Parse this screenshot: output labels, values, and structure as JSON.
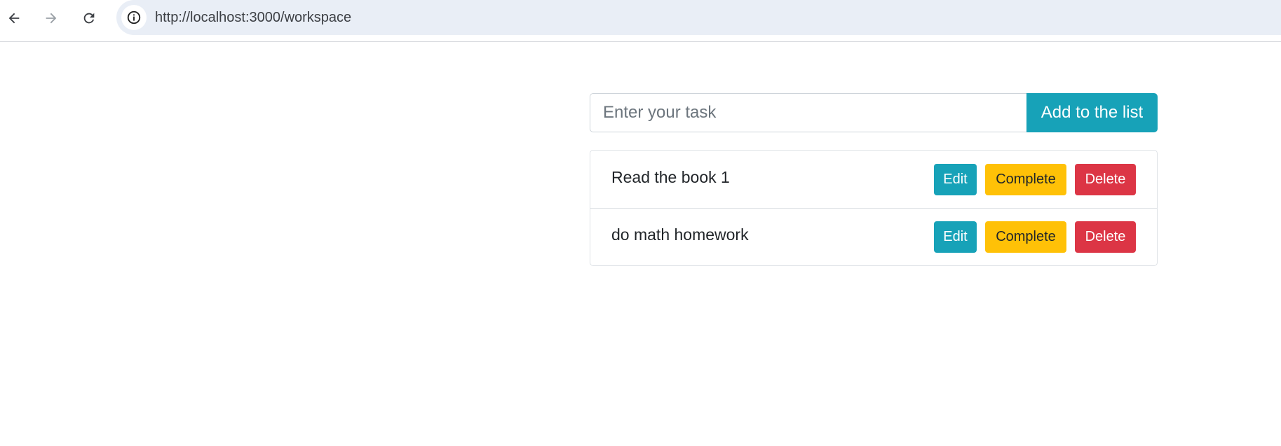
{
  "browser": {
    "url": "http://localhost:3000/workspace",
    "icons": {
      "back": "arrow-left-icon",
      "forward": "arrow-right-icon",
      "reload": "reload-icon",
      "site_info": "info-icon"
    }
  },
  "form": {
    "input_placeholder": "Enter your task",
    "input_value": "",
    "add_button_label": "Add to the list"
  },
  "tasks": [
    {
      "text": "Read the book 1",
      "edit_label": "Edit",
      "complete_label": "Complete",
      "delete_label": "Delete"
    },
    {
      "text": "do math homework",
      "edit_label": "Edit",
      "complete_label": "Complete",
      "delete_label": "Delete"
    }
  ],
  "colors": {
    "info": "#17a2b8",
    "warning": "#ffc107",
    "danger": "#dc3545",
    "address_bar": "#e9eef6"
  }
}
